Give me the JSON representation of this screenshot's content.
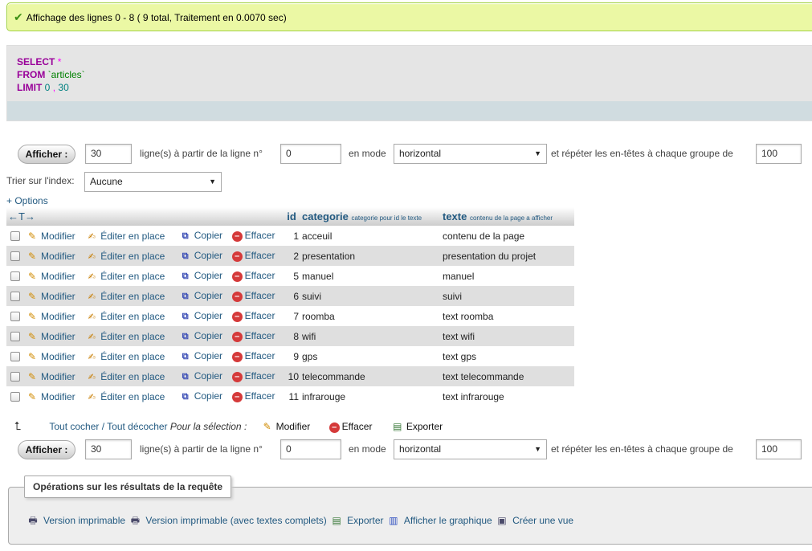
{
  "status": {
    "message": "Affichage des lignes 0 - 8 ( 9 total, Traitement en 0.0070 sec)"
  },
  "sql": {
    "kw_select": "SELECT",
    "star": "*",
    "kw_from": "FROM",
    "table": "`articles`",
    "kw_limit": "LIMIT",
    "limit_a": "0",
    "comma": ",",
    "limit_b": "30"
  },
  "nav": {
    "show_label": "Afficher :",
    "rows_value": "30",
    "from_row_label": "ligne(s) à partir de la ligne n°",
    "start_value": "0",
    "mode_label": "en mode",
    "mode_value": "horizontal",
    "repeat_label": "et répéter les en-têtes à chaque groupe de",
    "repeat_value": "100"
  },
  "nav_bottom": {
    "show_label": "Afficher :",
    "rows_value": "30",
    "from_row_label": "ligne(s) à partir de la ligne n°",
    "start_value": "0",
    "mode_label": "en mode",
    "mode_value": "horizontal",
    "repeat_label": "et répéter les en-têtes à chaque groupe de",
    "repeat_value": "100"
  },
  "sort": {
    "label": "Trier sur l'index:",
    "value": "Aucune"
  },
  "options_link": "+ Options",
  "table": {
    "arrows": "←T→",
    "headers": {
      "id": "id",
      "categorie": "categorie",
      "categorie_comment": "categorie pour id le texte",
      "texte": "texte",
      "texte_comment": "contenu de la page a afficher"
    },
    "actions": {
      "modify": "Modifier",
      "inline_edit": "Éditer en place",
      "copy": "Copier",
      "delete": "Effacer"
    },
    "rows": [
      {
        "id": "1",
        "categorie": "acceuil",
        "texte": "contenu de la page"
      },
      {
        "id": "2",
        "categorie": "presentation",
        "texte": "presentation du projet"
      },
      {
        "id": "5",
        "categorie": "manuel",
        "texte": "manuel"
      },
      {
        "id": "6",
        "categorie": "suivi",
        "texte": "suivi"
      },
      {
        "id": "7",
        "categorie": "roomba",
        "texte": "text roomba"
      },
      {
        "id": "8",
        "categorie": "wifi",
        "texte": "text wifi"
      },
      {
        "id": "9",
        "categorie": "gps",
        "texte": "text gps"
      },
      {
        "id": "10",
        "categorie": "telecommande",
        "texte": "text telecommande"
      },
      {
        "id": "11",
        "categorie": "infrarouge",
        "texte": "text infrarouge"
      }
    ]
  },
  "bulk": {
    "check_all": "Tout cocher / Tout décocher",
    "for_selection": "Pour la sélection :",
    "modify": "Modifier",
    "delete": "Effacer",
    "export": "Exporter"
  },
  "operations": {
    "legend": "Opérations sur les résultats de la requête",
    "print": "Version imprimable",
    "print_full": "Version imprimable (avec textes complets)",
    "export": "Exporter",
    "chart": "Afficher le graphique",
    "create_view": "Créer une vue"
  }
}
